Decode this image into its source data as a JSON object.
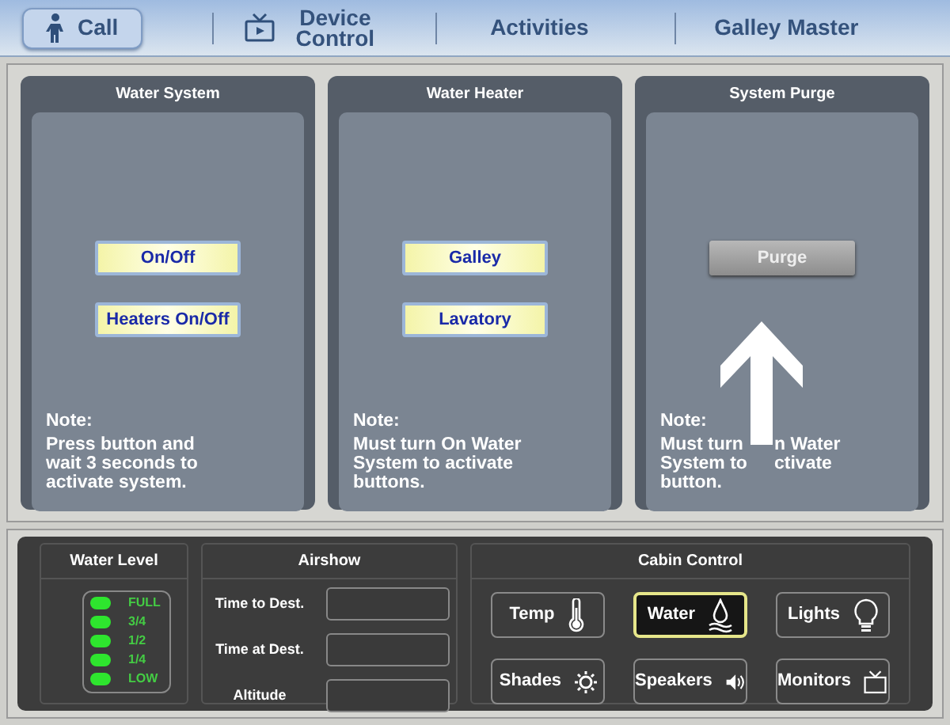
{
  "nav": [
    {
      "label": "Call",
      "kind": "person",
      "selected": true
    },
    {
      "label": "Device Control",
      "kind": "tv",
      "selected": false
    },
    {
      "label": "Activities",
      "selected": false
    },
    {
      "label": "Galley Master",
      "selected": false
    }
  ],
  "panels": [
    {
      "title": "Water System",
      "buttons": [
        {
          "label": "On/Off",
          "disabled": false
        },
        {
          "label": "Heaters On/Off",
          "disabled": false
        }
      ],
      "note_title": "Note:",
      "note_lines": [
        [
          "Press button and"
        ],
        [
          "wait 3 seconds to"
        ],
        [
          "activate system."
        ]
      ]
    },
    {
      "title": "Water Heater",
      "buttons": [
        {
          "label": "Galley",
          "disabled": false
        },
        {
          "label": "Lavatory",
          "disabled": false
        }
      ],
      "note_title": "Note:",
      "note_lines": [
        [
          "Must turn On Water"
        ],
        [
          "System to activate"
        ],
        [
          "buttons."
        ]
      ]
    },
    {
      "title": "System Purge",
      "buttons": [
        {
          "label": "Purge",
          "disabled": true
        }
      ],
      "note_title": "Note:",
      "note_lines": [
        [
          "Must turn",
          "n Water"
        ],
        [
          "System to",
          "ctivate"
        ],
        [
          "button."
        ]
      ],
      "pointer_arrow": true
    }
  ],
  "water_level": {
    "title": "Water Level",
    "marks": [
      {
        "label": "FULL",
        "on": true
      },
      {
        "label": "3/4",
        "on": true
      },
      {
        "label": "1/2",
        "on": true
      },
      {
        "label": "1/4",
        "on": true
      },
      {
        "label": "LOW",
        "on": true
      }
    ]
  },
  "airshow": {
    "title": "Airshow",
    "fields": [
      {
        "label": "Time to Dest."
      },
      {
        "label": "Time at Dest."
      },
      {
        "label": "Altitude"
      }
    ]
  },
  "cabin_control": {
    "title": "Cabin Control",
    "buttons": [
      {
        "label": "Temp",
        "kind": "thermometer",
        "selected": false
      },
      {
        "label": "Water",
        "kind": "drop",
        "selected": true
      },
      {
        "label": "Lights",
        "kind": "bulb",
        "selected": false
      },
      {
        "label": "Shades",
        "kind": "sun",
        "selected": false
      },
      {
        "label": "Speakers",
        "kind": "speaker",
        "selected": false
      },
      {
        "label": "Monitors",
        "kind": "tv",
        "selected": false
      }
    ]
  }
}
